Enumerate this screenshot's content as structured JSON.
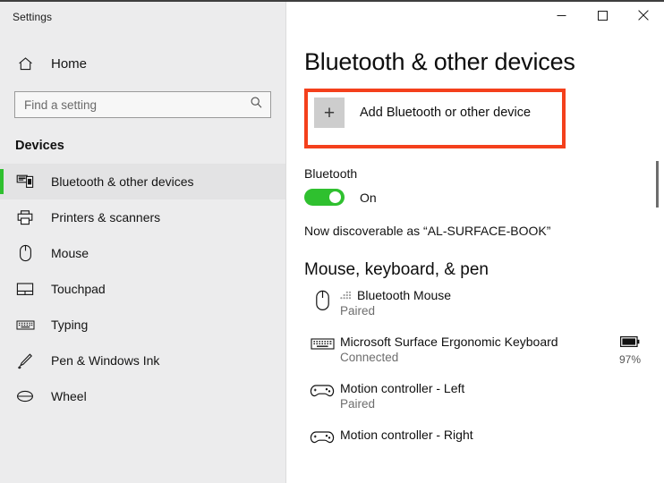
{
  "window": {
    "app_title": "Settings",
    "controls": {
      "minimize": "minimize-button",
      "maximize": "maximize-button",
      "close": "close-button"
    }
  },
  "sidebar": {
    "home_label": "Home",
    "home_icon": "home-icon",
    "search": {
      "placeholder": "Find a setting",
      "value": "",
      "icon": "search-icon"
    },
    "section_title": "Devices",
    "items": [
      {
        "label": "Bluetooth & other devices",
        "icon": "bluetooth-devices-icon",
        "selected": true
      },
      {
        "label": "Printers & scanners",
        "icon": "printer-icon",
        "selected": false
      },
      {
        "label": "Mouse",
        "icon": "mouse-icon",
        "selected": false
      },
      {
        "label": "Touchpad",
        "icon": "touchpad-icon",
        "selected": false
      },
      {
        "label": "Typing",
        "icon": "keyboard-icon",
        "selected": false
      },
      {
        "label": "Pen & Windows Ink",
        "icon": "pen-icon",
        "selected": false
      },
      {
        "label": "Wheel",
        "icon": "wheel-icon",
        "selected": false
      }
    ]
  },
  "main": {
    "page_title": "Bluetooth & other devices",
    "add_device": {
      "label": "Add Bluetooth or other device",
      "plus_icon": "plus-icon",
      "highlight_color": "#f4401c"
    },
    "bluetooth": {
      "heading": "Bluetooth",
      "toggle_state": "On",
      "toggle_on": true,
      "toggle_color": "#2fc02f",
      "discoverable_text": "Now discoverable as “AL-SURFACE-BOOK”"
    },
    "devices_group": {
      "title": "Mouse, keyboard, & pen",
      "items": [
        {
          "name": "Bluetooth Mouse",
          "status": "Paired",
          "icon": "mouse-icon",
          "prefix_icon": "bluetooth-signal-icon",
          "battery": null
        },
        {
          "name": "Microsoft Surface Ergonomic Keyboard",
          "status": "Connected",
          "icon": "keyboard-icon",
          "prefix_icon": null,
          "battery": "97%"
        },
        {
          "name": "Motion controller - Left",
          "status": "Paired",
          "icon": "gamepad-icon",
          "prefix_icon": null,
          "battery": null
        },
        {
          "name": "Motion controller - Right",
          "status": "",
          "icon": "gamepad-icon",
          "prefix_icon": null,
          "battery": null
        }
      ]
    }
  }
}
